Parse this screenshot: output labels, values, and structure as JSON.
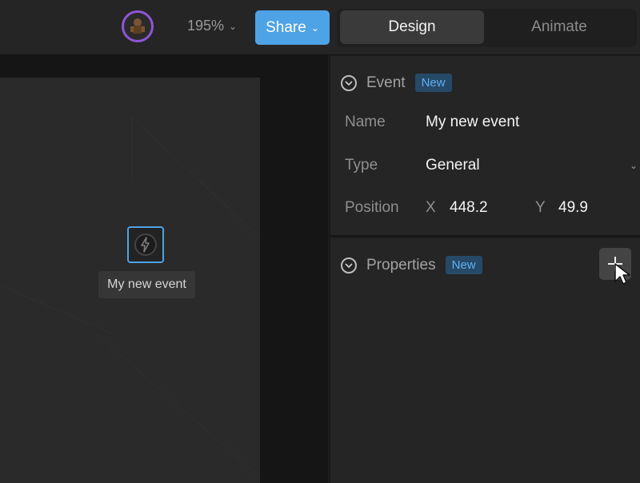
{
  "toolbar": {
    "zoom_value": "195%",
    "share_label": "Share",
    "modes": {
      "design": "Design",
      "animate": "Animate"
    },
    "active_mode": "Design",
    "colors": {
      "share": "#4ea3e6",
      "avatar_ring": "#8e55d6"
    }
  },
  "canvas": {
    "event_node_label": "My new event",
    "event_node_icon": "lightning-icon"
  },
  "event_panel": {
    "title": "Event",
    "badge": "New",
    "name_label": "Name",
    "name_value": "My new event",
    "type_label": "Type",
    "type_value": "General",
    "position_label": "Position",
    "x_label": "X",
    "x_value": "448.2",
    "y_label": "Y",
    "y_value": "49.9"
  },
  "properties_panel": {
    "title": "Properties",
    "badge": "New",
    "add_icon": "plus-icon"
  }
}
